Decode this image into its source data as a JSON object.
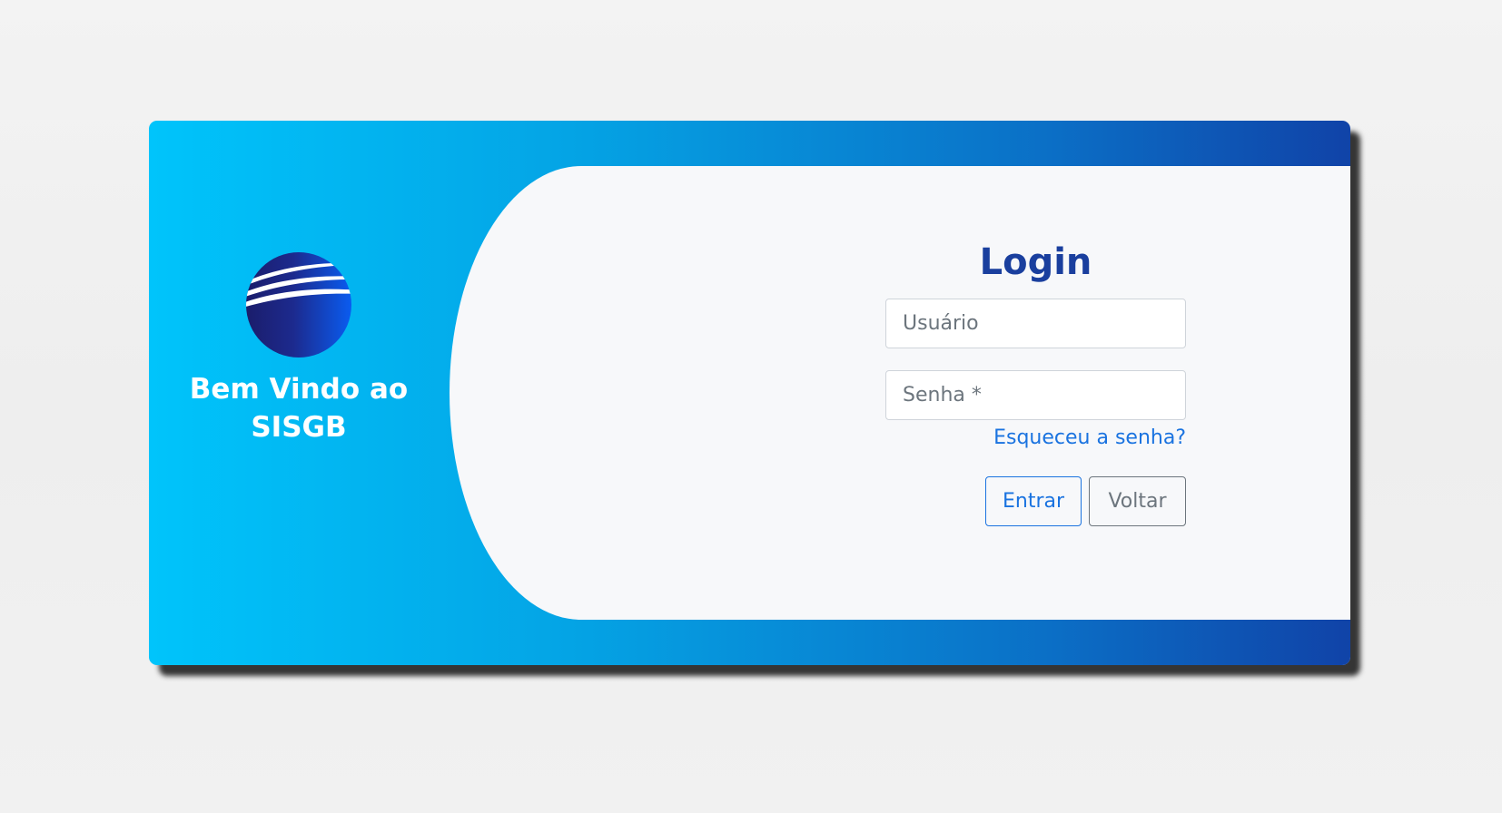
{
  "brand": {
    "logo_icon": "globe-stripes-logo-icon",
    "welcome_text": "Bem Vindo ao\nSISGB"
  },
  "login": {
    "title": "Login",
    "username_placeholder": "Usuário",
    "password_placeholder": "Senha *",
    "forgot_password": "Esqueceu a senha?",
    "enter_label": "Entrar",
    "back_label": "Voltar"
  },
  "colors": {
    "gradient_start": "#00c4fb",
    "gradient_end": "#1043a8",
    "title_blue": "#1a3f9e",
    "link_blue": "#1a73e0",
    "panel_background": "#f7f8fa"
  }
}
